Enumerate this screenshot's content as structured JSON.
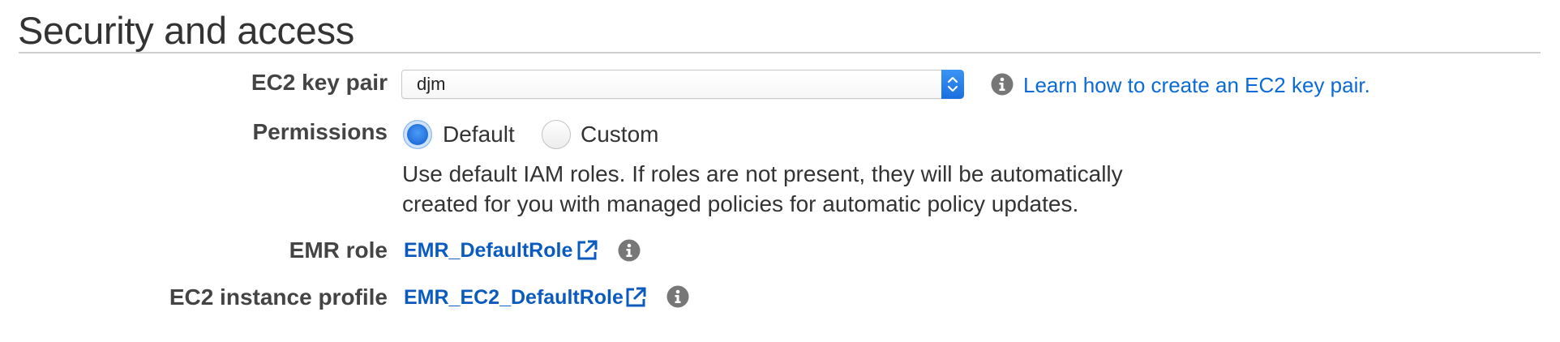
{
  "section": {
    "title": "Security and access"
  },
  "key_pair": {
    "label": "EC2 key pair",
    "selected": "djm",
    "help_link": "Learn how to create an EC2 key pair."
  },
  "permissions": {
    "label": "Permissions",
    "options": [
      {
        "label": "Default",
        "checked": true
      },
      {
        "label": "Custom",
        "checked": false
      }
    ],
    "description": "Use default IAM roles. If roles are not present, they will be automatically created for you with managed policies for automatic policy updates."
  },
  "emr_role": {
    "label": "EMR role",
    "value": "EMR_DefaultRole"
  },
  "instance_profile": {
    "label": "EC2 instance profile",
    "value": "EMR_EC2_DefaultRole"
  },
  "icons": {
    "info": "info-icon",
    "external_link": "external-link-icon",
    "select_arrows": "chevron-up-down-icon"
  },
  "colors": {
    "link": "#0b6ad6",
    "accent": "#1f6fd8",
    "icon_gray": "#777777"
  }
}
